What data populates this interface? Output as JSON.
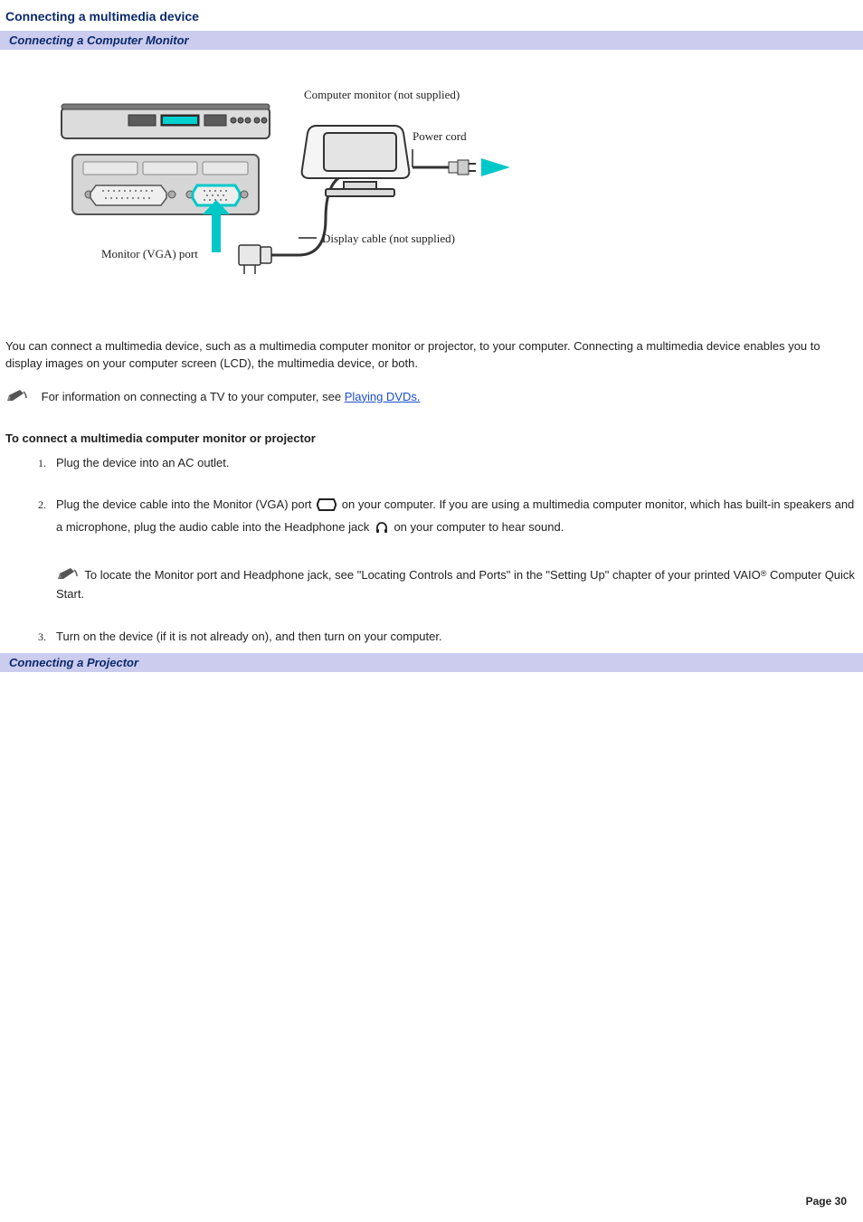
{
  "title": "Connecting a multimedia device",
  "section1_bar": "Connecting a Computer Monitor",
  "figure": {
    "label_monitor_title": "Computer monitor (not supplied)",
    "label_power_cord": "Power cord",
    "label_display_cable": "Display cable (not supplied)",
    "label_vga_port": "Monitor (VGA) port"
  },
  "intro_para": "You can connect a multimedia device, such as a multimedia computer monitor or projector, to your computer. Connecting a multimedia device enables you to display images on your computer screen (LCD), the multimedia device, or both.",
  "note1_prefix": "For information on connecting a TV to your computer, see ",
  "note1_link": "Playing DVDs.",
  "subhead": "To connect a multimedia computer monitor or projector",
  "steps": {
    "s1": "Plug the device into an AC outlet.",
    "s2a": "Plug the device cable into the Monitor (VGA) port ",
    "s2b": " on your computer. If you are using a multimedia computer monitor, which has built-in speakers and a microphone, plug the audio cable into the Headphone jack ",
    "s2c": " on your computer to hear sound.",
    "s2_note": " To locate the Monitor port and Headphone jack, see \"Locating Controls and Ports\" in the \"Setting Up\" chapter of your printed VAIO",
    "s2_note_suffix": " Computer Quick Start.",
    "s3": "Turn on the device (if it is not already on), and then turn on your computer."
  },
  "section2_bar": "Connecting a Projector",
  "page_number": "Page 30",
  "reg_mark": "®"
}
